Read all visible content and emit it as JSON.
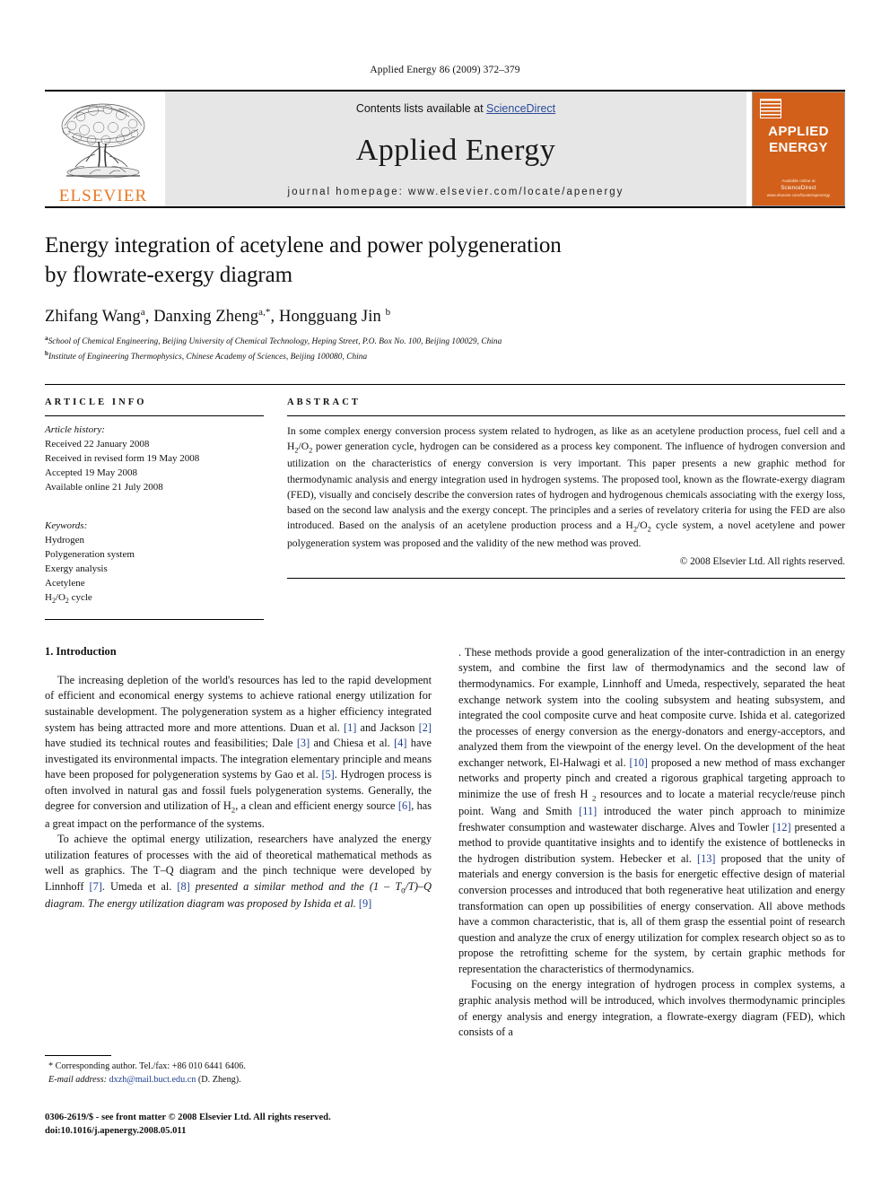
{
  "running_head": "Applied Energy 86 (2009) 372–379",
  "masthead": {
    "elsevier_wordmark": "ELSEVIER",
    "contents_prefix": "Contents lists available at ",
    "sciencedirect": "ScienceDirect",
    "journal_title": "Applied Energy",
    "homepage": "journal homepage: www.elsevier.com/locate/apenergy",
    "cover_title_line1": "APPLIED",
    "cover_title_line2": "ENERGY",
    "cover_footer_small": "Available online at",
    "cover_footer_sd": "ScienceDirect",
    "cover_footer_url": "www.elsevier.com/locate/apenergy"
  },
  "article": {
    "title_line1": "Energy integration of acetylene and power polygeneration",
    "title_line2": "by flowrate-exergy diagram",
    "authors": "Zhifang Wang",
    "author2": "Danxing Zheng",
    "author3": "Hongguang Jin",
    "affiliation_a": "School of Chemical Engineering, Beijing University of Chemical Technology, Heping Street, P.O. Box No. 100, Beijing 100029, China",
    "affiliation_b": "Institute of Engineering Thermophysics, Chinese Academy of Sciences, Beijing 100080, China"
  },
  "info": {
    "heading": "ARTICLE INFO",
    "history_label": "Article history:",
    "received": "Received 22 January 2008",
    "revised": "Received in revised form 19 May 2008",
    "accepted": "Accepted 19 May 2008",
    "online": "Available online 21 July 2008",
    "keywords_label": "Keywords:",
    "keywords": [
      "Hydrogen",
      "Polygeneration system",
      "Exergy analysis",
      "Acetylene"
    ],
    "keyword_h2o2": "cycle"
  },
  "abstract": {
    "heading": "ABSTRACT",
    "part1": "In some complex energy conversion process system related to hydrogen, as like as an acetylene production process, fuel cell and a H",
    "part2": " power generation cycle, hydrogen can be considered as a process key component. The influence of hydrogen conversion and utilization on the characteristics of energy conversion is very important. This paper presents a new graphic method for thermodynamic analysis and energy integration used in hydrogen systems. The proposed tool, known as the flowrate-exergy diagram (FED), visually and concisely describe the conversion rates of hydrogen and hydrogenous chemicals associating with the exergy loss, based on the second law analysis and the exergy concept. The principles and a series of revelatory criteria for using the FED are also introduced. Based on the analysis of an acetylene production process and a H",
    "part3": " cycle system, a novel acetylene and power polygeneration system was proposed and the validity of the new method was proved.",
    "copyright": "© 2008 Elsevier Ltd. All rights reserved."
  },
  "section1": {
    "heading": "1. Introduction",
    "p1_a": "The increasing depletion of the world's resources has led to the rapid development of efficient and economical energy systems to achieve rational energy utilization for sustainable development. The polygeneration system as a higher efficiency integrated system has being attracted more and more attentions. Duan et al. ",
    "ref1": "[1]",
    "p1_b": " and Jackson ",
    "ref2": "[2]",
    "p1_c": " have studied its technical routes and feasibilities; Dale ",
    "ref3": "[3]",
    "p1_d": " and Chiesa et al. ",
    "ref4": "[4]",
    "p1_e": " have investigated its environmental impacts. The integration elementary principle and means have been proposed for polygeneration systems by Gao et al. ",
    "ref5": "[5]",
    "p1_f": ". Hydrogen process is often involved in natural gas and fossil fuels polygeneration systems. Generally, the degree for conversion and utilization of H",
    "p1_g": ", a clean and efficient energy source ",
    "ref6": "[6]",
    "p1_h": ", has a great impact on the performance of the systems.",
    "p2_a": "To achieve the optimal energy utilization, researchers have analyzed the energy utilization features of processes with the aid of theoretical mathematical methods as well as graphics. The T–Q diagram and the pinch technique were developed by Linnhoff ",
    "ref7": "[7]",
    "p2_b": ". Umeda et al. ",
    "ref8": "[8]",
    "p2_c": " presented a similar method and the (1 – T",
    "p2_c2": "/T)–Q diagram. The energy utilization diagram was proposed by Ishida et al. ",
    "ref9": "[9]",
    "p2_d": ". These methods provide a good generalization of the inter-contradiction in an energy system, and combine the first law of thermodynamics and the second law of thermodynamics. For example, Linnhoff and Umeda, respectively, separated the heat exchange network system into the cooling subsystem and heating subsystem, and integrated the cool composite curve and heat composite curve. Ishida et al. categorized the processes of energy conversion as the energy-donators and energy-acceptors, and analyzed them from the viewpoint of the energy level. On the development of the heat exchanger network, El-Halwagi et al. ",
    "ref10": "[10]",
    "p2_e": " proposed a new method of mass exchanger networks and property pinch and created a rigorous graphical targeting approach to minimize the use of fresh H",
    "p2_f": " resources and to locate a material recycle/reuse pinch point. Wang and Smith ",
    "ref11": "[11]",
    "p2_g": " introduced the water pinch approach to minimize freshwater consumption and wastewater discharge. Alves and Towler ",
    "ref12": "[12]",
    "p2_h": " presented a method to provide quantitative insights and to identify the existence of bottlenecks in the hydrogen distribution system. Hebecker et al. ",
    "ref13": "[13]",
    "p2_i": " proposed that the unity of materials and energy conversion is the basis for energetic effective design of material conversion processes and introduced that both regenerative heat utilization and energy transformation can open up possibilities of energy conservation. All above methods have a common characteristic, that is, all of them grasp the essential point of research question and analyze the crux of energy utilization for complex research object so as to propose the retrofitting scheme for the system, by certain graphic methods for representation the characteristics of thermodynamics.",
    "p3": "Focusing on the energy integration of hydrogen process in complex systems, a graphic analysis method will be introduced, which involves thermodynamic principles of energy analysis and energy integration, a flowrate-exergy diagram (FED), which consists of a"
  },
  "footnote": {
    "corresponding": "* Corresponding author. Tel./fax: +86 010 6441 6406.",
    "email_label": "E-mail address:",
    "email": "dxzh@mail.buct.edu.cn",
    "email_suffix": " (D. Zheng)."
  },
  "imprint": {
    "line1": "0306-2619/$ - see front matter © 2008 Elsevier Ltd. All rights reserved.",
    "line2": "doi:10.1016/j.apenergy.2008.05.011"
  },
  "colors": {
    "link_blue": "#1f3f8f",
    "sciencedirect_blue": "#2a4b9b",
    "elsevier_orange": "#E87722",
    "cover_orange": "#D2601A",
    "band_gray": "#e6e6e6"
  }
}
